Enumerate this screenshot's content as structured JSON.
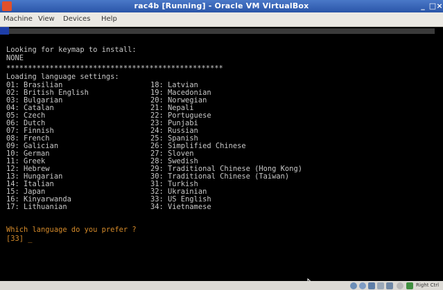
{
  "window": {
    "title": "rac4b [Running] - Oracle VM VirtualBox",
    "controls": [
      "_",
      "□",
      "×"
    ]
  },
  "menu": {
    "machine": "Machine",
    "view": "View",
    "devices": "Devices",
    "help": "Help"
  },
  "console": {
    "line_keymap": "Looking for keymap to install:",
    "line_none": "NONE",
    "line_stars": "**************************************************",
    "line_loading": "Loading language settings:",
    "languages_col1": [
      "01: Brasilian",
      "02: British English",
      "03: Bulgarian",
      "04: Catalan",
      "05: Czech",
      "06: Dutch",
      "07: Finnish",
      "08: French",
      "09: Galician",
      "10: German",
      "11: Greek",
      "12: Hebrew",
      "13: Hungarian",
      "14: Italian",
      "15: Japan",
      "16: Kinyarwanda",
      "17: Lithuanian"
    ],
    "languages_col2": [
      "18: Latvian",
      "19: Macedonian",
      "20: Norwegian",
      "21: Nepali",
      "22: Portuguese",
      "23: Punjabi",
      "24: Russian",
      "25: Spanish",
      "26: Simplified Chinese",
      "27: Sloven",
      "28: Swedish",
      "29: Traditional Chinese (Hong Kong)",
      "30: Traditional Chinese (Taiwan)",
      "31: Turkish",
      "32: Ukrainian",
      "33: US English",
      "34: Vietnamese"
    ],
    "prompt": "Which language do you prefer ?",
    "input_line": "[33] _"
  },
  "statusbar": {
    "host_key": "Right Ctrl"
  },
  "colors": {
    "terminal_bg": "#000000",
    "terminal_text": "#c8c8c8",
    "prompt_text": "#d48a2a",
    "titlebar": "#2a55a8"
  }
}
